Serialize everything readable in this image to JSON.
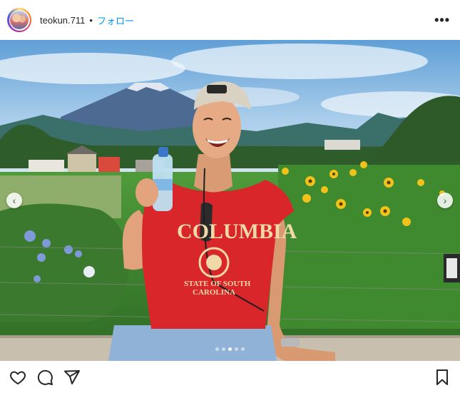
{
  "header": {
    "username": "teokun.711",
    "separator": "•",
    "follow_label": "フォロー",
    "more_icon": "more-horizontal-icon"
  },
  "post": {
    "image_alt": "Man in red COLUMBIA shirt laughing, holding a water bottle, sunflowers and Mount Fuji behind",
    "shirt_text_main": "COLUMBIA",
    "shirt_text_sub1": "STATE OF SOUTH",
    "shirt_text_sub2": "CAROLINA",
    "carousel": {
      "total": 5,
      "active_index": 2
    }
  },
  "actions": {
    "icons": [
      "heart-icon",
      "comment-icon",
      "share-icon",
      "bookmark-icon"
    ]
  },
  "colors": {
    "follow_blue": "#0095f6",
    "shirt_red": "#d8262b"
  }
}
